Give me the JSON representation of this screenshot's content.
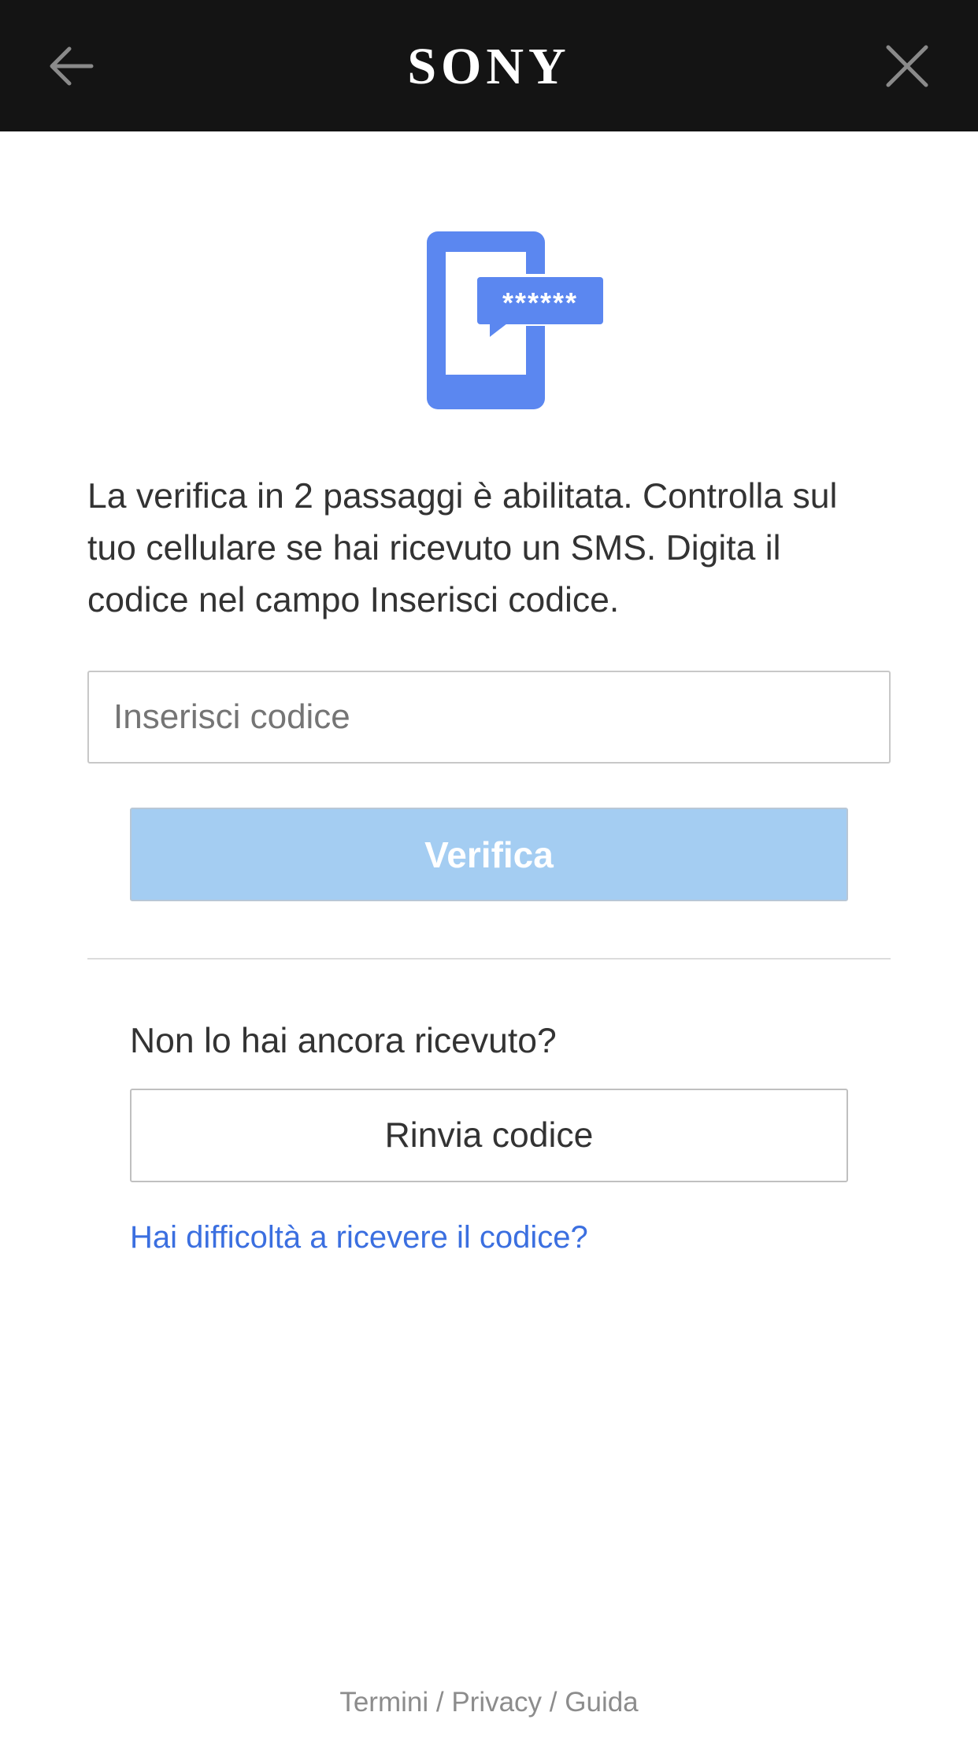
{
  "header": {
    "logo": "SONY",
    "back_icon": "arrow-left-icon",
    "close_icon": "close-icon"
  },
  "hero": {
    "icon": "phone-sms-code-icon",
    "code_mask": "******"
  },
  "main": {
    "description": "La verifica in 2 passaggi è abilitata. Controlla sul tuo cellulare se hai ricevuto un SMS. Digita il codice nel campo Inserisci codice.",
    "code_input": {
      "value": "",
      "placeholder": "Inserisci codice"
    },
    "verify_label": "Verifica",
    "not_received_text": "Non lo hai ancora ricevuto?",
    "resend_label": "Rinvia codice",
    "help_link": "Hai difficoltà a ricevere il codice?"
  },
  "footer": {
    "terms": "Termini",
    "privacy": "Privacy",
    "help": "Guida",
    "separator": " / "
  },
  "colors": {
    "header_bg": "#141414",
    "icon_blue": "#5b87f0",
    "button_disabled": "#a4cdf2",
    "link": "#3b6fe0"
  }
}
